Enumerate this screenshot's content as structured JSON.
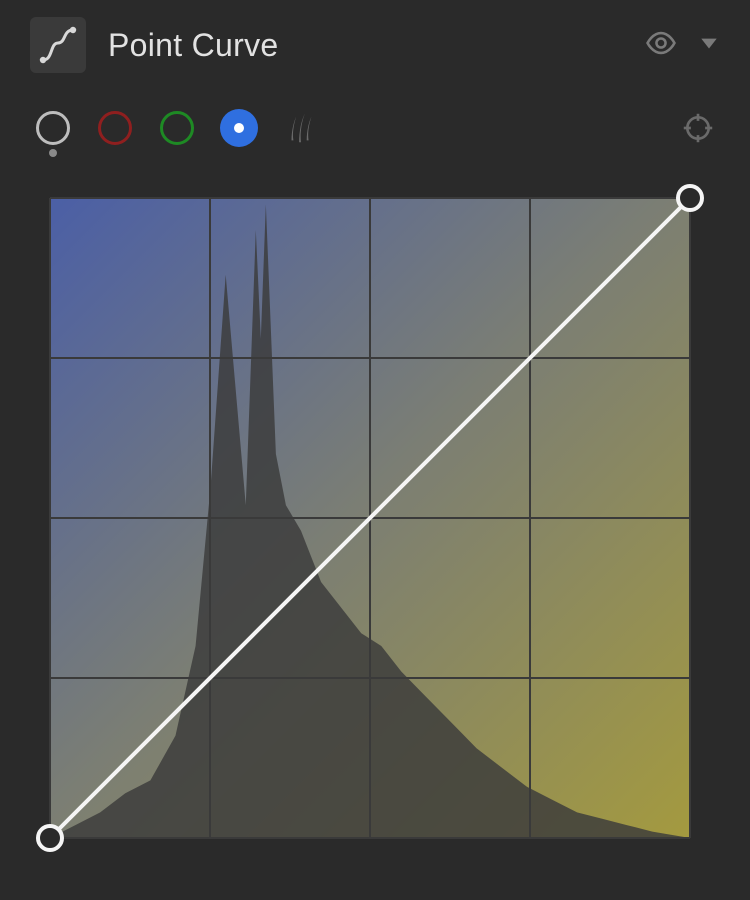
{
  "header": {
    "title": "Point Curve"
  },
  "channels": {
    "luma": {
      "name": "luma",
      "color": "#bdbdbd"
    },
    "red": {
      "name": "red",
      "color": "#8f1f1f"
    },
    "green": {
      "name": "green",
      "color": "#1e8a24"
    },
    "blue": {
      "name": "blue",
      "color": "#2f6fe0",
      "selected": true
    }
  },
  "curve": {
    "grid_divisions": 4,
    "points": [
      {
        "x": 0,
        "y": 0
      },
      {
        "x": 255,
        "y": 255
      }
    ],
    "gradient": {
      "top_left": "#4b5fa6",
      "bottom_right": "#a49a3f"
    }
  },
  "chart_data": {
    "type": "area",
    "title": "",
    "xlabel": "",
    "ylabel": "",
    "xlim": [
      0,
      255
    ],
    "ylim": [
      0,
      255
    ],
    "series": [
      {
        "name": "curve",
        "x": [
          0,
          255
        ],
        "y": [
          0,
          255
        ]
      }
    ],
    "histogram": {
      "x": [
        0,
        10,
        20,
        30,
        40,
        50,
        58,
        64,
        70,
        74,
        78,
        82,
        84,
        86,
        90,
        94,
        100,
        108,
        116,
        124,
        132,
        140,
        150,
        160,
        170,
        180,
        190,
        200,
        210,
        220,
        230,
        240,
        255
      ],
      "values": [
        0,
        2,
        4,
        7,
        9,
        16,
        30,
        55,
        88,
        70,
        52,
        95,
        78,
        99,
        60,
        52,
        48,
        40,
        36,
        32,
        30,
        26,
        22,
        18,
        14,
        11,
        8,
        6,
        4,
        3,
        2,
        1,
        0
      ]
    }
  }
}
